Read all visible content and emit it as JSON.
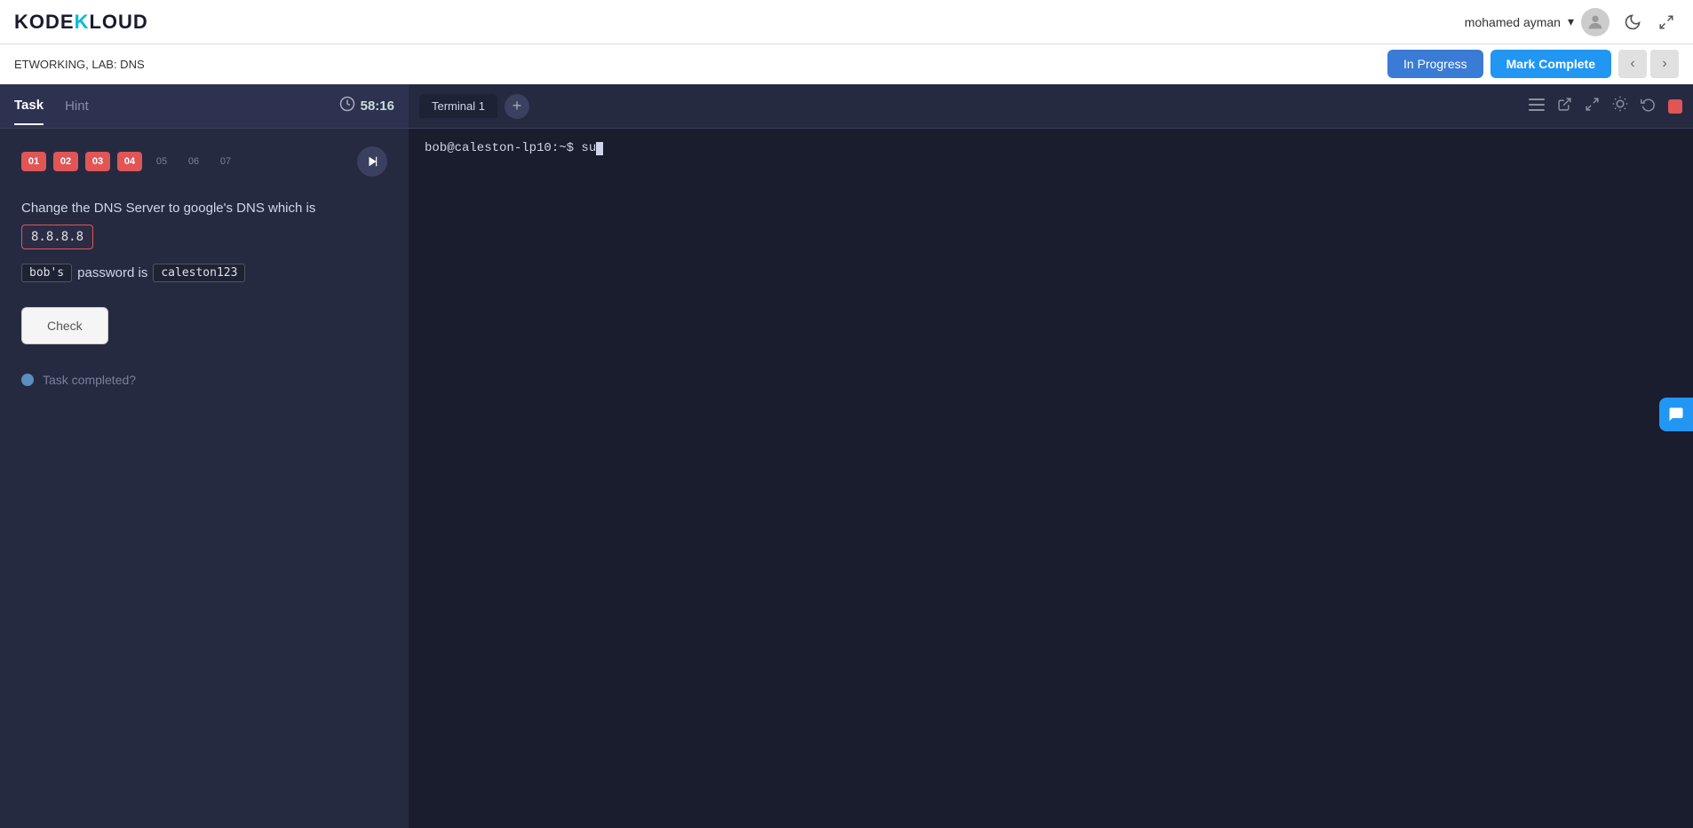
{
  "header": {
    "logo": "KODEKLOUD",
    "user_name": "mohamed ayman",
    "chevron": "▾",
    "moon_icon": "☾",
    "compress_icon": "⤡"
  },
  "sub_header": {
    "breadcrumb": "ETWORKING, LAB: DNS",
    "btn_in_progress": "In Progress",
    "btn_mark_complete": "Mark Complete"
  },
  "left_panel": {
    "tab_task": "Task",
    "tab_hint": "Hint",
    "timer": "58:16",
    "steps": [
      "01",
      "02",
      "03",
      "04",
      "05",
      "06",
      "07"
    ],
    "steps_completed": [
      0,
      1,
      2,
      3
    ],
    "task_description": "Change the DNS Server to google's DNS which is",
    "dns_value": "8.8.8.8",
    "password_prefix": "bob's",
    "password_middle": "password is",
    "password_value": "caleston123",
    "check_label": "Check",
    "task_completed_label": "Task completed?"
  },
  "terminal": {
    "tab_label": "Terminal 1",
    "add_icon": "+",
    "prompt_text": "bob@caleston-lp10:~$ su",
    "cursor": ""
  },
  "icons": {
    "menu": "≡",
    "external_link": "⬡",
    "fullscreen": "⛶",
    "brightness": "☀",
    "history": "↺",
    "chat": "💬"
  }
}
